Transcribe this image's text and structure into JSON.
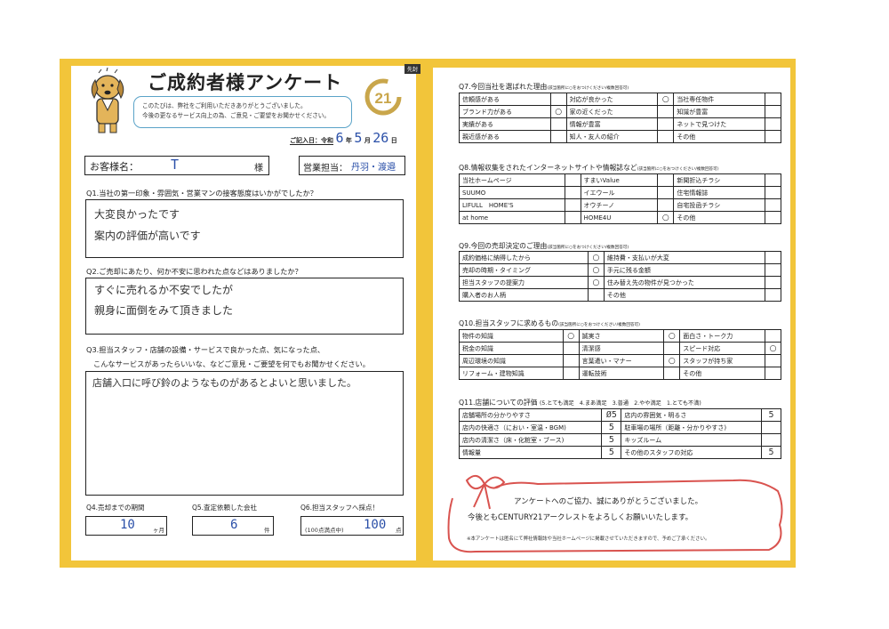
{
  "colors": {
    "frame": "#f2c53a",
    "accent_blue": "#5aa3c8",
    "ribbon": "#d9534f",
    "logo_gold": "#c9a64b"
  },
  "header": {
    "tag": "先封",
    "title": "ご成約者様アンケート",
    "bubble_line1": "このたびは、弊社をご利用いただきありがとうございました。",
    "bubble_line2": "今後の更なるサービス向上の為、ご意見・ご要望をお聞かせください。",
    "logo_text": "21",
    "date_prefix": "ご記入日：令和",
    "date_year": "6",
    "date_year_unit": "年",
    "date_month": "5",
    "date_month_unit": "月",
    "date_day": "26",
    "date_day_unit": "日"
  },
  "customer": {
    "label": "お客様名：",
    "name": "T",
    "suffix": "様"
  },
  "staff": {
    "label": "営業担当：",
    "names": "丹羽・渡邉"
  },
  "q1": {
    "question": "Q1.当社の第一印象・雰囲気・営業マンの接客態度はいかがでしたか？",
    "answer_line1": "大変良かったです",
    "answer_line2": "案内の評価が高いです"
  },
  "q2": {
    "question": "Q2.ご売却にあたり、何か不安に思われた点などはありましたか？",
    "answer_line1": "すぐに売れるか不安でしたが",
    "answer_line2": "親身に面倒をみて頂きました"
  },
  "q3": {
    "question_line1": "Q3.担当スタッフ・店舗の設備・サービスで良かった点、気になった点、",
    "question_line2": "こんなサービスがあったらいいな、などご意見・ご要望を何でもお聞かせください。",
    "answer_line1": "店舗入口に呼び鈴のようなものがあるとよいと思いました。"
  },
  "q4": {
    "label": "Q4.売却までの期間",
    "value": "10",
    "unit": "ヶ月"
  },
  "q5": {
    "label": "Q5.査定依頼した会社",
    "value": "6",
    "unit": "件"
  },
  "q6": {
    "label": "Q6.担当スタッフへ採点！",
    "prefix": "(100点満点中)",
    "value": "100",
    "unit": "点"
  },
  "q7": {
    "title": "Q7.今回当社を選ばれた理由",
    "note": "(該当箇所に○をおつけください/複数回答可)",
    "rows": [
      [
        "信頼感がある",
        "",
        "対応が良かった",
        "○",
        "当社専任物件",
        ""
      ],
      [
        "ブランド力がある",
        "○",
        "家の近くだった",
        "",
        "知識が豊富",
        ""
      ],
      [
        "実績がある",
        "",
        "情報が豊富",
        "",
        "ネットで見つけた",
        ""
      ],
      [
        "親近感がある",
        "",
        "知人・友人の紹介",
        "",
        "その他",
        ""
      ]
    ]
  },
  "q8": {
    "title": "Q8.情報収集をされたインターネットサイトや情報誌など",
    "note": "(該当箇所に○をおつけください/複数回答可)",
    "rows": [
      [
        "当社ホームページ",
        "",
        "すまいValue",
        "",
        "新聞折込チラシ",
        ""
      ],
      [
        "SUUMO",
        "",
        "イエウール",
        "",
        "住宅情報誌",
        ""
      ],
      [
        "LIFULL　HOME'S",
        "",
        "オウチーノ",
        "",
        "自宅投函チラシ",
        ""
      ],
      [
        "at home",
        "",
        "HOME4U",
        "○",
        "その他",
        ""
      ]
    ]
  },
  "q9": {
    "title": "Q9.今回の売却決定のご理由",
    "note": "(該当箇所に○をおつけください/複数回答可)",
    "rows": [
      [
        "成約価格に納得したから",
        "○",
        "維持費・支払いが大変",
        ""
      ],
      [
        "売却の時期・タイミング",
        "○",
        "手元に残る金額",
        ""
      ],
      [
        "担当スタッフの提案力",
        "○",
        "住み替え先の物件が見つかった",
        ""
      ],
      [
        "購入者のお人柄",
        "",
        "その他",
        ""
      ]
    ]
  },
  "q10": {
    "title": "Q10.担当スタッフに求めるもの",
    "note": "(該当箇所に○をおつけください/複数回答可)",
    "rows": [
      [
        "物件の知識",
        "○",
        "誠実さ",
        "○",
        "面白さ・トーク力",
        ""
      ],
      [
        "税金の知識",
        "",
        "清潔感",
        "",
        "スピード対応",
        "○"
      ],
      [
        "周辺環境の知識",
        "",
        "言葉遣い・マナー",
        "○",
        "スタッフが持ち家",
        ""
      ],
      [
        "リフォーム・建物知識",
        "",
        "運転技術",
        "",
        "その他",
        ""
      ]
    ]
  },
  "q11": {
    "title": "Q11.店舗についての評価",
    "scale": "(5.とても満足　4.まあ満足　3.普通　2.やや満足　1.とても不満)",
    "rows": [
      [
        "店舗場所の分かりやすさ",
        "Ø5",
        "店内の雰囲気・明るさ",
        "5"
      ],
      [
        "店内の快適さ（におい・室温・BGM)",
        "5",
        "駐車場の場所（距離・分かりやすさ)",
        ""
      ],
      [
        "店内の清潔さ（床・化粧室・ブース)",
        "5",
        "キッズルーム",
        ""
      ],
      [
        "情報量",
        "5",
        "その他のスタッフの対応",
        "5"
      ]
    ]
  },
  "thanks": {
    "line1": "アンケートへのご協力、誠にありがとうございました。",
    "line2": "今後ともCENTURY21アークレストをよろしくお願いいたします。",
    "note": "※本アンケートは匿名にて弊社情報誌や当社ホームページに掲載させていただきますので、予めご了承ください。"
  }
}
